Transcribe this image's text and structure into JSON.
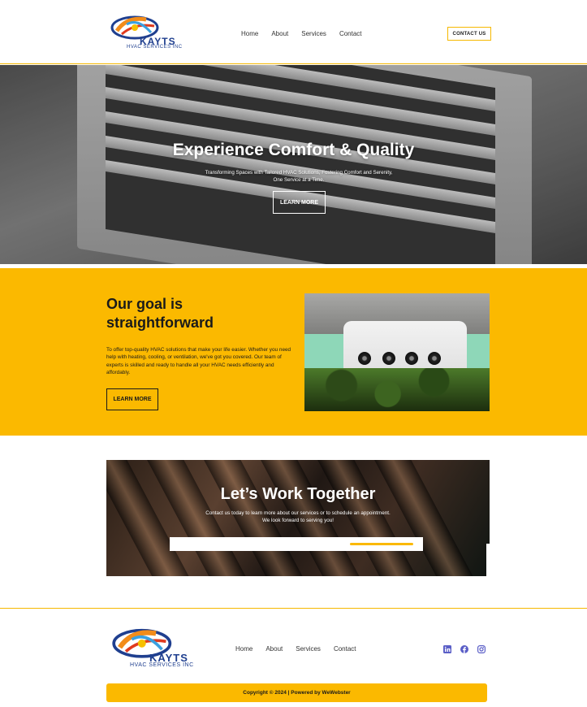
{
  "header": {
    "logo_text": "KAYTS",
    "logo_sub": "HVAC SERVICES INC",
    "nav": [
      "Home",
      "About",
      "Services",
      "Contact"
    ],
    "cta": "CONTACT US"
  },
  "hero": {
    "title": "Experience Comfort & Quality",
    "subtitle": "Transforming Spaces with Tailored HVAC Solutions, Fostering Comfort and Serenity, One Service at a Time.",
    "button": "LEARN MORE"
  },
  "goal": {
    "title": "Our goal is straightforward",
    "body": "To offer top-quality HVAC solutions that make your life easier. Whether you need help with heating, cooling, or ventilation, we've got you covered. Our team of experts is skilled and ready to handle all your HVAC needs efficiently and affordably.",
    "button": "LEARN MORE"
  },
  "work": {
    "title": "Let’s Work Together",
    "body": "Contact us today to learn more about our services or to schedule an appointment. We look forward to serving you!"
  },
  "footer": {
    "logo_text": "KAYTS",
    "logo_sub": "HVAC SERVICES INC",
    "nav": [
      "Home",
      "About",
      "Services",
      "Contact"
    ],
    "social_icons": [
      "linkedin-icon",
      "facebook-icon",
      "instagram-icon"
    ],
    "copyright": "Copyright © 2024 | Powered by WeWebster"
  },
  "colors": {
    "accent": "#fbb900",
    "brand_blue": "#1f3f8f",
    "social": "#5b5fc7"
  }
}
